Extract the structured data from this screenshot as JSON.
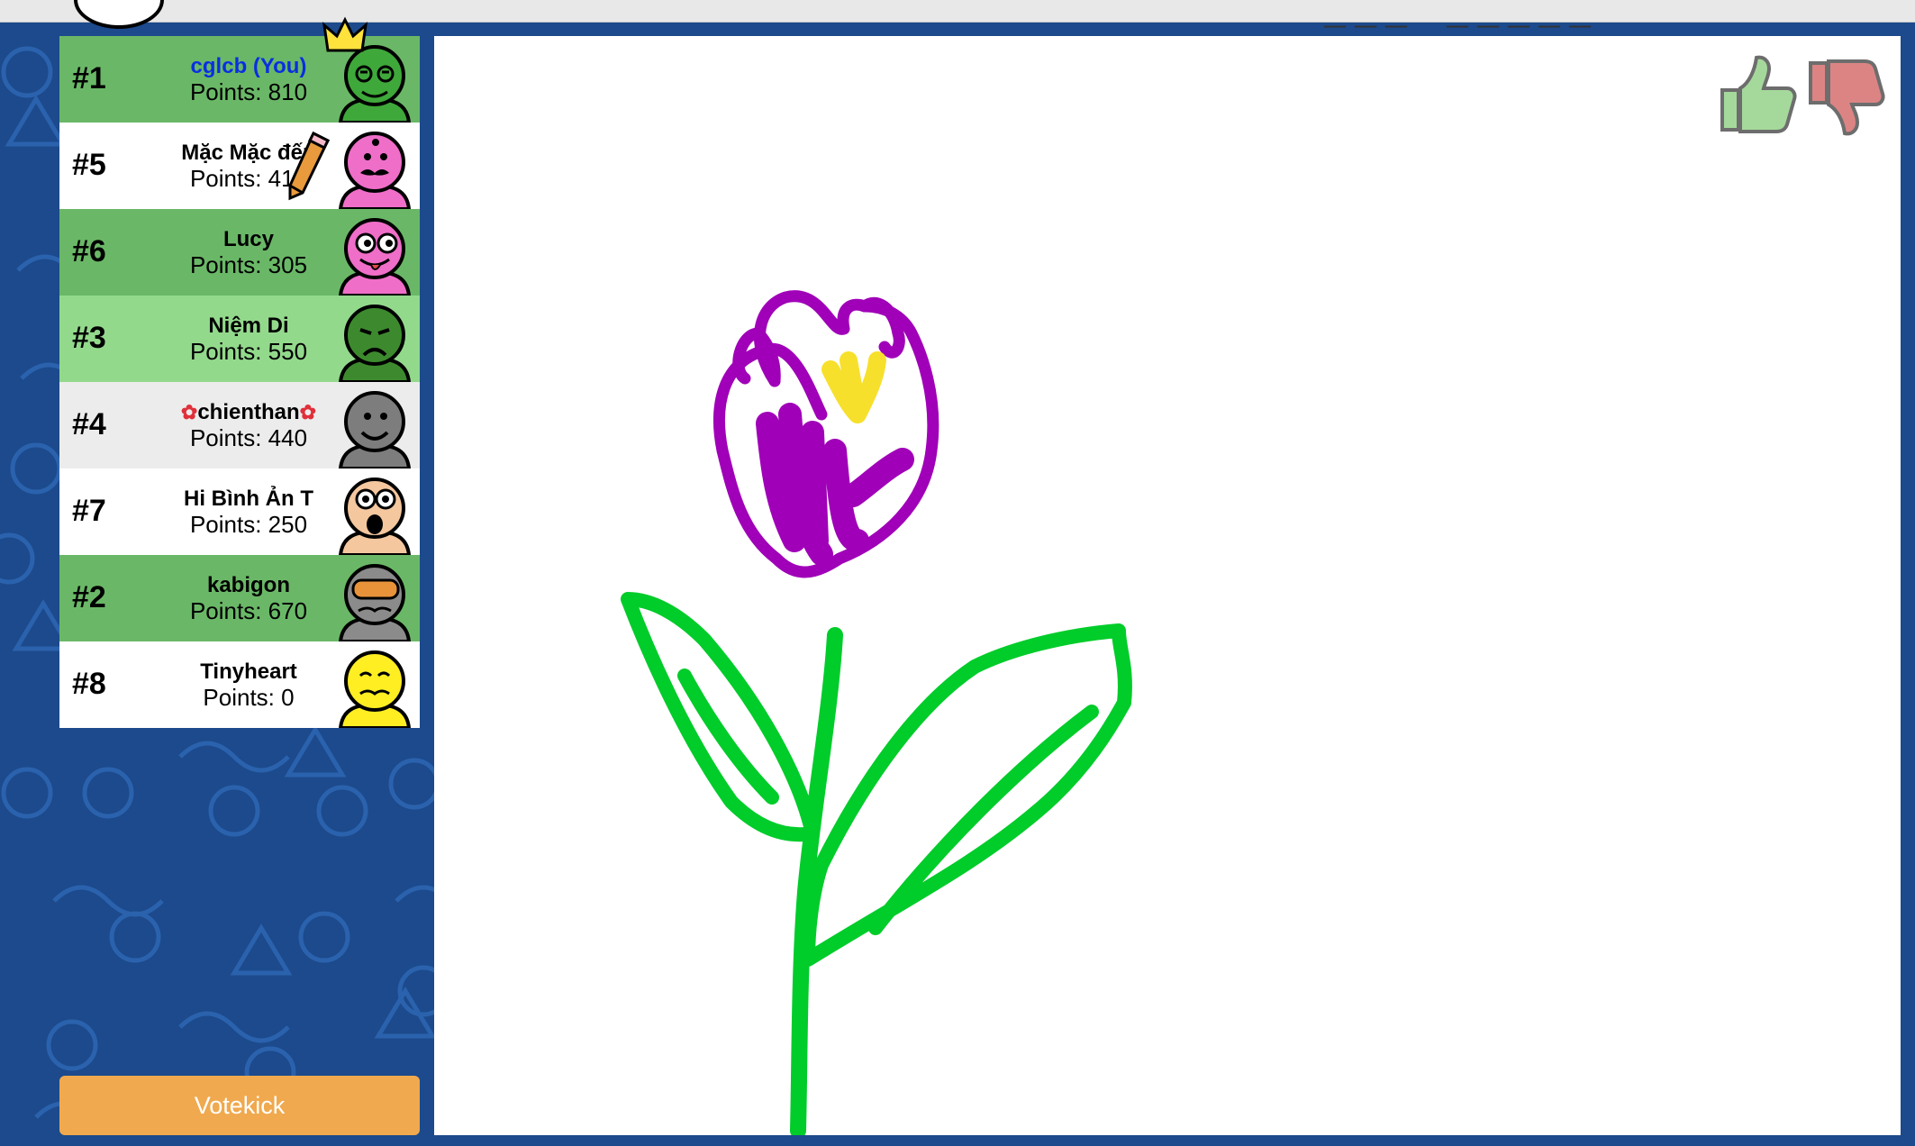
{
  "header": {
    "word_hint": "___ _____"
  },
  "players": [
    {
      "rank": "#1",
      "name": "cglcb (You)",
      "points_text": "Points: 810",
      "is_you": true,
      "row_color": "#6ab867",
      "avatar_color": "#3fa83a",
      "avatar_face": "frog",
      "badge": "crown-icon"
    },
    {
      "rank": "#5",
      "name": "Mặc Mặc đến",
      "points_text": "Points: 410",
      "is_you": false,
      "row_color": "#ffffff",
      "avatar_color": "#ef6ec8",
      "avatar_face": "mustache",
      "badge": "pencil-icon"
    },
    {
      "rank": "#6",
      "name": "Lucy",
      "points_text": "Points: 305",
      "is_you": false,
      "row_color": "#6ab867",
      "avatar_color": "#ef6ec8",
      "avatar_face": "silly"
    },
    {
      "rank": "#3",
      "name": "Niệm Di",
      "points_text": "Points: 550",
      "is_you": false,
      "row_color": "#93d98c",
      "avatar_color": "#3d8a2e",
      "avatar_face": "sad"
    },
    {
      "rank": "#4",
      "name": "chienthan",
      "name_decoration": "hibiscus-icon",
      "points_text": "Points: 440",
      "is_you": false,
      "row_color": "#ececec",
      "avatar_color": "#7d7d7d",
      "avatar_face": "smile"
    },
    {
      "rank": "#7",
      "name": "Hi Bình Ản T",
      "points_text": "Points: 250",
      "is_you": false,
      "row_color": "#ffffff",
      "avatar_color": "#f4c79f",
      "avatar_face": "shocked"
    },
    {
      "rank": "#2",
      "name": "kabigon",
      "points_text": "Points: 670",
      "is_you": false,
      "row_color": "#6ab867",
      "avatar_color": "#8b8b8b",
      "avatar_face": "goggles"
    },
    {
      "rank": "#8",
      "name": "Tinyheart",
      "points_text": "Points: 0",
      "is_you": false,
      "row_color": "#ffffff",
      "avatar_color": "#ffee22",
      "avatar_face": "happy"
    }
  ],
  "controls": {
    "votekick_label": "Votekick",
    "like_icon": "thumbs-up-icon",
    "dislike_icon": "thumbs-down-icon"
  },
  "colors": {
    "background": "#1c4a8c",
    "votekick": "#f0a94e",
    "highlight_row": "#6ab867",
    "you_name": "#0a2fe0",
    "stroke_purple": "#a000b8",
    "stroke_green": "#00cc2a",
    "stroke_yellow": "#f7e02c"
  },
  "drawing": {
    "subject_icon": "flower-drawing"
  }
}
